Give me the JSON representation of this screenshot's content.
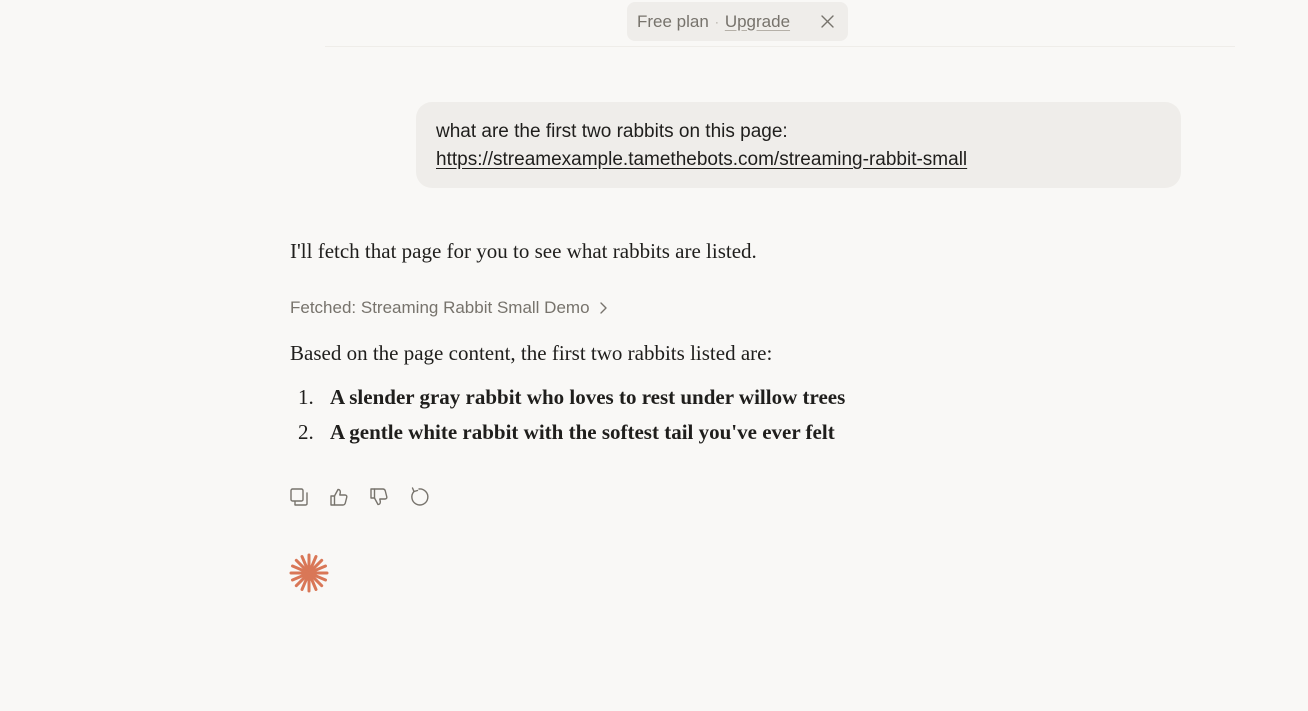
{
  "banner": {
    "plan_label": "Free plan",
    "separator": "·",
    "upgrade_label": "Upgrade"
  },
  "user_message": {
    "text": "what are the first two rabbits on this page:",
    "link": "https://streamexample.tamethebots.com/streaming-rabbit-small"
  },
  "assistant": {
    "intro": "I'll fetch that page for you to see what rabbits are listed.",
    "fetched_label": "Fetched: Streaming Rabbit Small Demo",
    "summary": "Based on the page content, the first two rabbits listed are:",
    "rabbits": [
      {
        "number": "1.",
        "text": "A slender gray rabbit who loves to rest under willow trees"
      },
      {
        "number": "2.",
        "text": "A gentle white rabbit with the softest tail you've ever felt"
      }
    ]
  },
  "actions": [
    {
      "icon": "copy-icon"
    },
    {
      "icon": "thumbs-up-icon"
    },
    {
      "icon": "thumbs-down-icon"
    },
    {
      "icon": "retry-icon"
    }
  ],
  "colors": {
    "background": "#f9f8f6",
    "bubble": "#efedea",
    "muted_text": "#77736c",
    "accent_spark": "#d97757"
  }
}
